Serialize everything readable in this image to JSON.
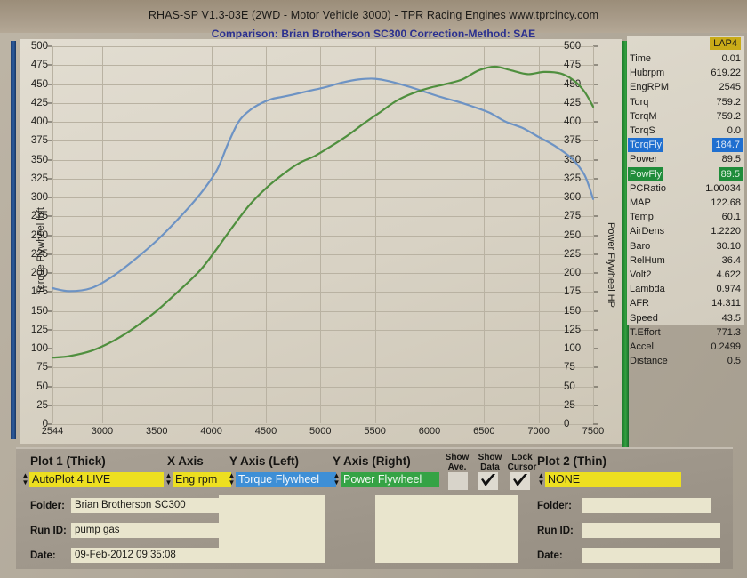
{
  "header": {
    "title": "RHAS-SP V1.3-03E  (2WD - Motor Vehicle 3000) - TPR Racing Engines    www.tprcincy.com",
    "subtitle": "Comparison: Brian Brotherson SC300    Correction-Method: SAE"
  },
  "chart_data": {
    "type": "line",
    "title": "Comparison: Brian Brotherson SC300",
    "xlabel": "Eng rpm",
    "ylabel_left": "Torque Flywheel lbft",
    "ylabel_right": "Power Flywheel HP",
    "xlim": [
      2544,
      7500
    ],
    "ylim": [
      0,
      500
    ],
    "grid": true,
    "x_ticks": [
      2544,
      3000,
      3500,
      4000,
      4500,
      5000,
      5500,
      6000,
      6500,
      7000,
      7500
    ],
    "y_ticks": [
      0,
      25,
      50,
      75,
      100,
      125,
      150,
      175,
      200,
      225,
      250,
      275,
      300,
      325,
      350,
      375,
      400,
      425,
      450,
      475,
      500
    ],
    "series": [
      {
        "name": "Torque Flywheel",
        "color": "#6d93c4",
        "axis": "left",
        "x": [
          2544,
          2700,
          2900,
          3100,
          3300,
          3500,
          3700,
          3900,
          4050,
          4150,
          4250,
          4350,
          4450,
          4550,
          4650,
          4750,
          4900,
          5050,
          5200,
          5350,
          5500,
          5650,
          5800,
          5950,
          6100,
          6250,
          6400,
          6550,
          6700,
          6850,
          7000,
          7150,
          7300,
          7420,
          7500
        ],
        "y": [
          180,
          176,
          180,
          196,
          218,
          243,
          272,
          305,
          336,
          370,
          400,
          415,
          424,
          430,
          433,
          436,
          441,
          446,
          452,
          456,
          457,
          453,
          447,
          440,
          433,
          427,
          420,
          412,
          400,
          392,
          380,
          368,
          352,
          330,
          298
        ]
      },
      {
        "name": "Power Flywheel",
        "color": "#4f8f3e",
        "axis": "right",
        "x": [
          2544,
          2700,
          2900,
          3100,
          3300,
          3500,
          3700,
          3900,
          4050,
          4200,
          4350,
          4500,
          4650,
          4800,
          4950,
          5100,
          5250,
          5400,
          5550,
          5700,
          5850,
          6000,
          6150,
          6300,
          6450,
          6600,
          6750,
          6900,
          7050,
          7200,
          7320,
          7420,
          7500
        ],
        "y": [
          88,
          90,
          97,
          110,
          128,
          150,
          176,
          204,
          232,
          262,
          290,
          312,
          330,
          345,
          355,
          368,
          382,
          398,
          413,
          428,
          438,
          445,
          450,
          456,
          468,
          473,
          468,
          463,
          466,
          464,
          455,
          440,
          420
        ]
      }
    ]
  },
  "data_panel": {
    "lap_header": "LAP4",
    "rows": [
      {
        "name": "Time",
        "value": "0.01",
        "highlight": "none"
      },
      {
        "name": "Hubrpm",
        "value": "619.22",
        "highlight": "none"
      },
      {
        "name": "EngRPM",
        "value": "2545",
        "highlight": "none"
      },
      {
        "name": "Torq",
        "value": "759.2",
        "highlight": "none"
      },
      {
        "name": "TorqM",
        "value": "759.2",
        "highlight": "none"
      },
      {
        "name": "TorqS",
        "value": "0.0",
        "highlight": "none"
      },
      {
        "name": "TorqFly",
        "value": "184.7",
        "highlight": "blue"
      },
      {
        "name": "Power",
        "value": "89.5",
        "highlight": "none"
      },
      {
        "name": "PowFly",
        "value": "89.5",
        "highlight": "green"
      },
      {
        "name": "PCRatio",
        "value": "1.00034",
        "highlight": "none"
      },
      {
        "name": "MAP",
        "value": "122.68",
        "highlight": "none"
      },
      {
        "name": "Temp",
        "value": "60.1",
        "highlight": "none"
      },
      {
        "name": "AirDens",
        "value": "1.2220",
        "highlight": "none"
      },
      {
        "name": "Baro",
        "value": "30.10",
        "highlight": "none"
      },
      {
        "name": "RelHum",
        "value": "36.4",
        "highlight": "none"
      },
      {
        "name": "Volt2",
        "value": "4.622",
        "highlight": "none"
      },
      {
        "name": "Lambda",
        "value": "0.974",
        "highlight": "none"
      },
      {
        "name": "AFR",
        "value": "14.311",
        "highlight": "none"
      },
      {
        "name": "Speed",
        "value": "43.5",
        "highlight": "none"
      },
      {
        "name": "T.Effort",
        "value": "771.3",
        "highlight": "none"
      },
      {
        "name": "Accel",
        "value": "0.2499",
        "highlight": "none"
      },
      {
        "name": "Distance",
        "value": "0.5",
        "highlight": "none"
      }
    ]
  },
  "controls": {
    "plot1_label": "Plot 1 (Thick)",
    "plot1_value": "AutoPlot 4 LIVE",
    "xaxis_label": "X Axis",
    "xaxis_value": "Eng rpm",
    "yleft_label": "Y Axis (Left)",
    "yleft_value": "Torque Flywheel",
    "yright_label": "Y Axis (Right)",
    "yright_value": "Power Flywheel",
    "show_ave_label": "Show\nAve.",
    "show_data_label": "Show\nData",
    "lock_cursor_label": "Lock\nCursor",
    "plot2_label": "Plot 2 (Thin)",
    "plot2_value": "NONE",
    "plot1_folder_label": "Folder:",
    "plot1_folder_value": "Brian Brotherson SC300",
    "plot1_runid_label": "Run ID:",
    "plot1_runid_value": "pump gas",
    "plot1_date_label": "Date:",
    "plot1_date_value": "09-Feb-2012  09:35:08",
    "plot2_folder_label": "Folder:",
    "plot2_folder_value": "",
    "plot2_runid_label": "Run ID:",
    "plot2_runid_value": "",
    "plot2_date_label": "Date:",
    "plot2_date_value": ""
  }
}
